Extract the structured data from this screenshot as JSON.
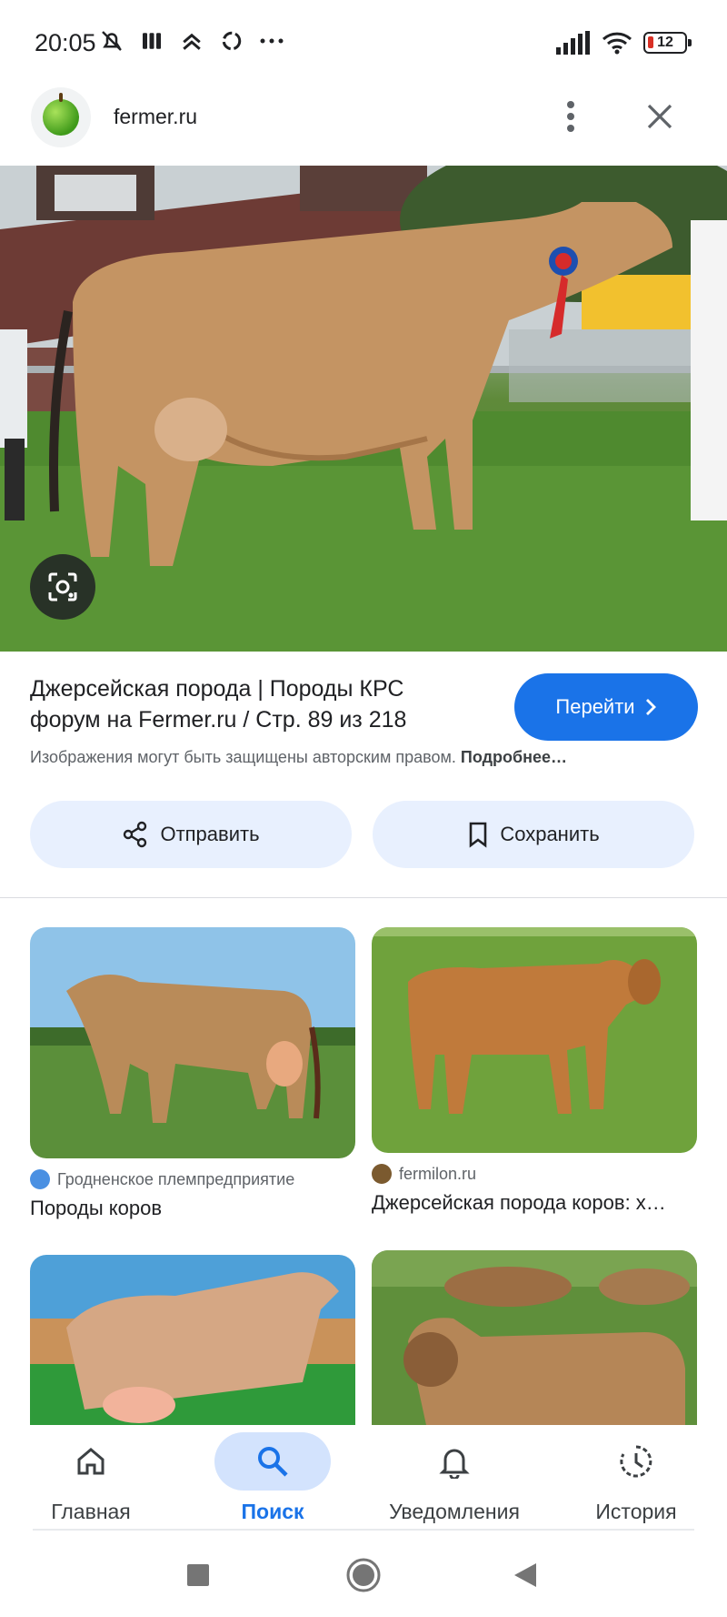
{
  "status_bar": {
    "time": "20:05",
    "battery": "12"
  },
  "header": {
    "site": "fermer.ru"
  },
  "result": {
    "title": "Джерсейская порода | Породы КРС форум на Fermer.ru / Стр. 89 из 218",
    "go_label": "Перейти",
    "copyright_text": "Изображения могут быть защищены авторским правом.",
    "copyright_more": "Подробнее…",
    "share_label": "Отправить",
    "save_label": "Сохранить"
  },
  "related": [
    {
      "source": "Гродненское племпредприятие",
      "title": "Породы коров"
    },
    {
      "source": "fermilon.ru",
      "title": "Джерсейская порода коров: х…"
    },
    {
      "source": "",
      "title": ""
    },
    {
      "source": "",
      "title": ""
    }
  ],
  "bottom_nav": {
    "items": [
      {
        "label": "Главная",
        "icon": "home-icon"
      },
      {
        "label": "Поиск",
        "icon": "search-icon",
        "active": true
      },
      {
        "label": "Уведомления",
        "icon": "bell-icon"
      },
      {
        "label": "История",
        "icon": "history-icon"
      }
    ]
  },
  "colors": {
    "accent": "#1a73e8",
    "chip_bg": "#e8f0fe"
  }
}
